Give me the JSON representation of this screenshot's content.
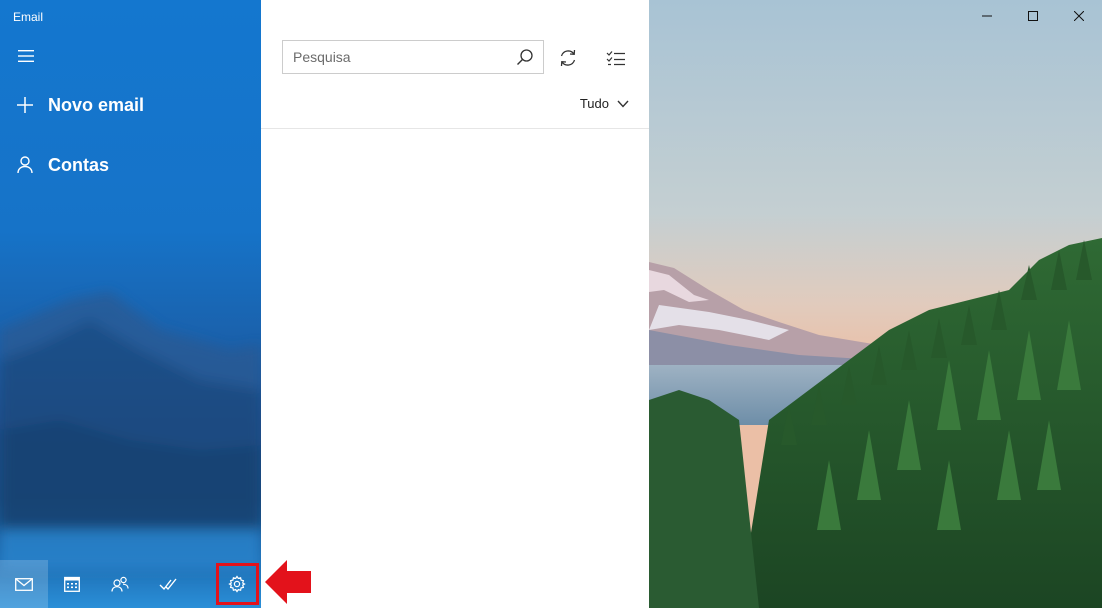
{
  "app": {
    "title": "Email"
  },
  "sidebar": {
    "menu_icon": "hamburger-menu-icon",
    "new_email_label": "Novo email",
    "accounts_label": "Contas",
    "bottom_nav": [
      {
        "name": "mail",
        "icon": "mail-icon",
        "active": true
      },
      {
        "name": "calendar",
        "icon": "calendar-icon",
        "active": false
      },
      {
        "name": "people",
        "icon": "people-icon",
        "active": false
      },
      {
        "name": "todo",
        "icon": "todo-check-icon",
        "active": false
      },
      {
        "name": "settings",
        "icon": "gear-icon",
        "active": false,
        "highlighted": true
      }
    ]
  },
  "message_list": {
    "search": {
      "placeholder": "Pesquisa",
      "value": ""
    },
    "filter_label": "Tudo"
  },
  "colors": {
    "sidebar_blue": "#1477cf",
    "highlight_red": "#e3121b"
  }
}
